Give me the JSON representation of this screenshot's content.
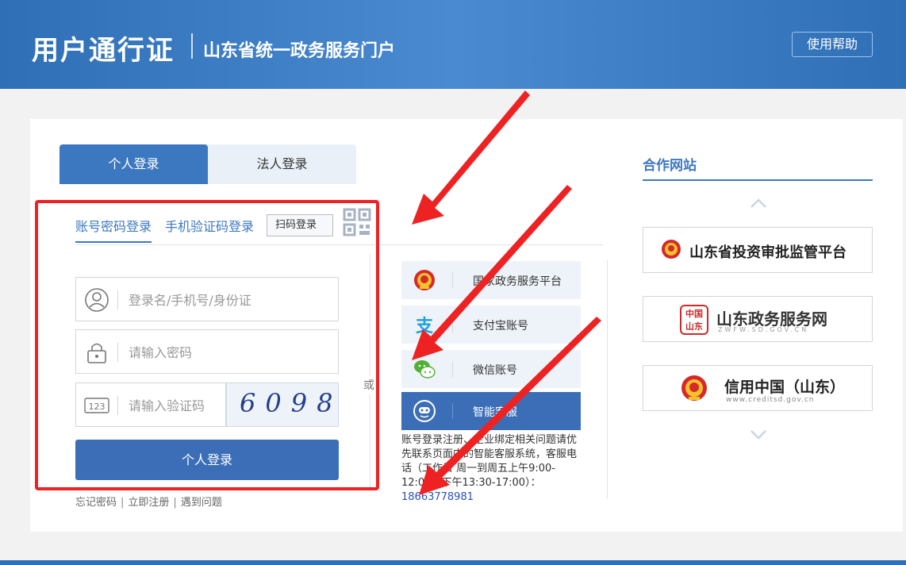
{
  "header": {
    "brand": "用户通行证",
    "subtitle": "山东省统一政务服务门户",
    "help_label": "使用帮助"
  },
  "login": {
    "tabs": [
      {
        "label": "个人登录",
        "active": true
      },
      {
        "label": "法人登录",
        "active": false
      }
    ],
    "subtabs": {
      "password": "账号密码登录",
      "sms": "手机验证码登录",
      "scan": "扫码登录"
    },
    "fields": {
      "username_placeholder": "登录名/手机号/身份证",
      "password_placeholder": "请输入密码",
      "captcha_placeholder": "请输入验证码",
      "captcha_icon_text": "123"
    },
    "captcha_text": "6098",
    "submit_label": "个人登录",
    "links": [
      "忘记密码",
      "立即注册",
      "遇到问题"
    ]
  },
  "or_label": "或",
  "alt_login": [
    {
      "label": "国家政务服务平台",
      "icon": "national-emblem-icon"
    },
    {
      "label": "支付宝账号",
      "icon": "alipay-icon"
    },
    {
      "label": "微信账号",
      "icon": "wechat-icon"
    },
    {
      "label": "智能客服",
      "icon": "customer-service-icon"
    }
  ],
  "note": {
    "text": "账号登录注册、企业绑定相关问题请优先联系页面中的智能客服系统，客服电话（工作日 周一到周五上午9:00-12:00，下午13:30-17:00）：",
    "phone": "18663778981"
  },
  "partners": {
    "title": "合作网站",
    "sites": [
      {
        "name": "山东省投资审批监管平台"
      },
      {
        "name": "山东政务服务网",
        "seal": "中国山东",
        "sub": "ZWFW.SD.GOV.CN"
      },
      {
        "name": "信用中国（山东）",
        "sub": "www.creditsd.gov.cn"
      }
    ]
  },
  "colors": {
    "header": "#2f6fb5",
    "accent": "#3c78c0",
    "button": "#3c6eb7",
    "annotation_red": "#ee2222"
  }
}
